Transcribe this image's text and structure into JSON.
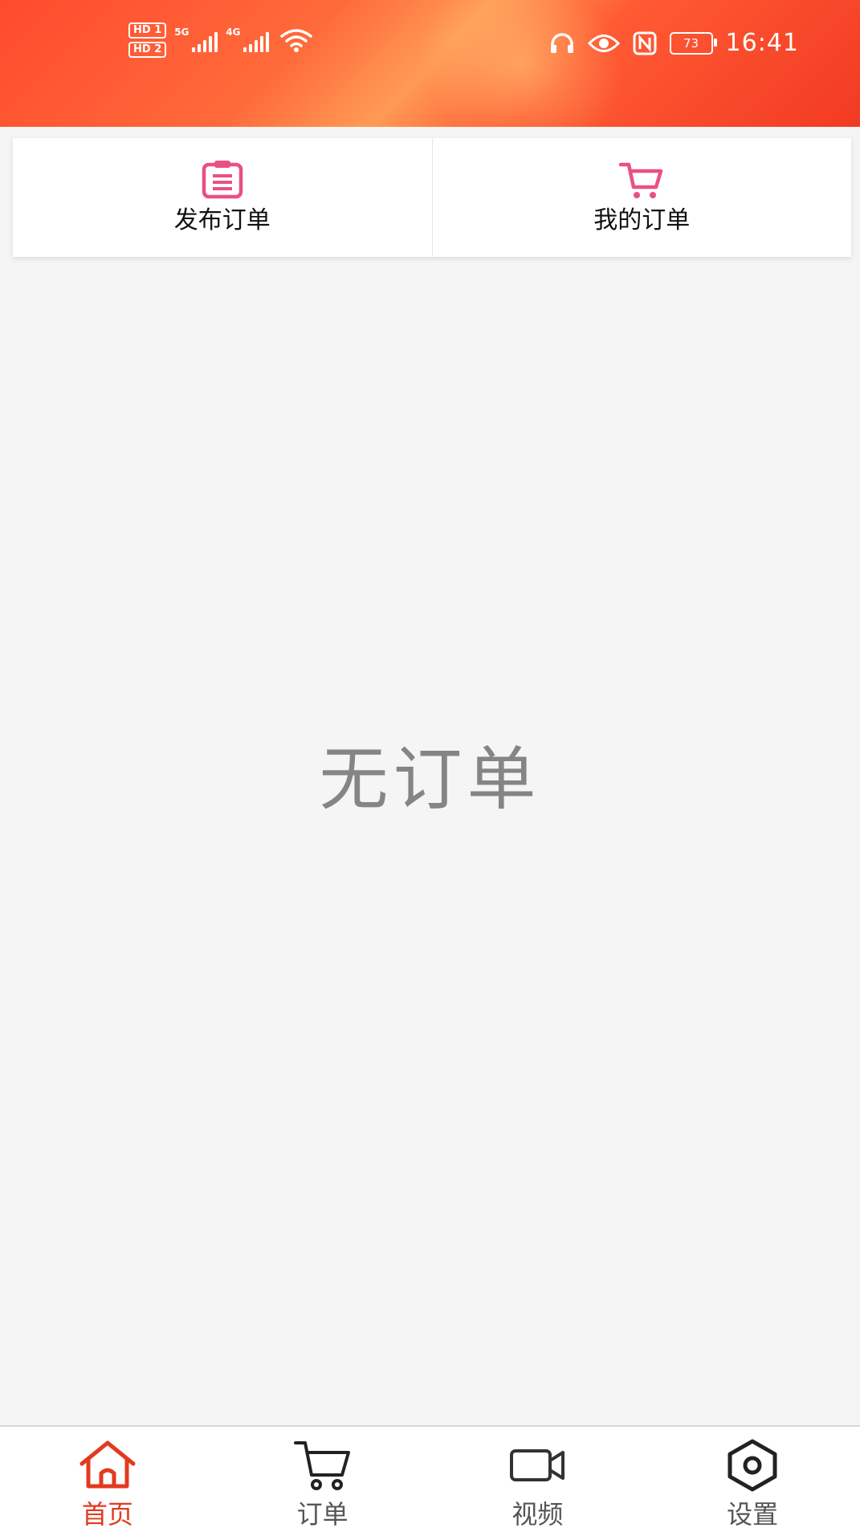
{
  "status_bar": {
    "hd1": "HD 1",
    "hd2": "HD 2",
    "sig1_label": "5G",
    "sig2_label": "4G",
    "battery": "73",
    "time": "16:41"
  },
  "top_actions": [
    {
      "label": "发布订单",
      "icon": "clipboard-icon"
    },
    {
      "label": "我的订单",
      "icon": "cart-icon"
    }
  ],
  "empty_state": "无订单",
  "tabbar": {
    "active_index": 0,
    "active_color": "#e33a1f",
    "items": [
      {
        "label": "首页",
        "icon": "home-icon"
      },
      {
        "label": "订单",
        "icon": "cart-icon"
      },
      {
        "label": "视频",
        "icon": "video-camera-icon"
      },
      {
        "label": "设置",
        "icon": "settings-hexagon-icon"
      }
    ]
  },
  "colors": {
    "accent_pink": "#ea4f86",
    "header_red": "#ff4a2e"
  }
}
